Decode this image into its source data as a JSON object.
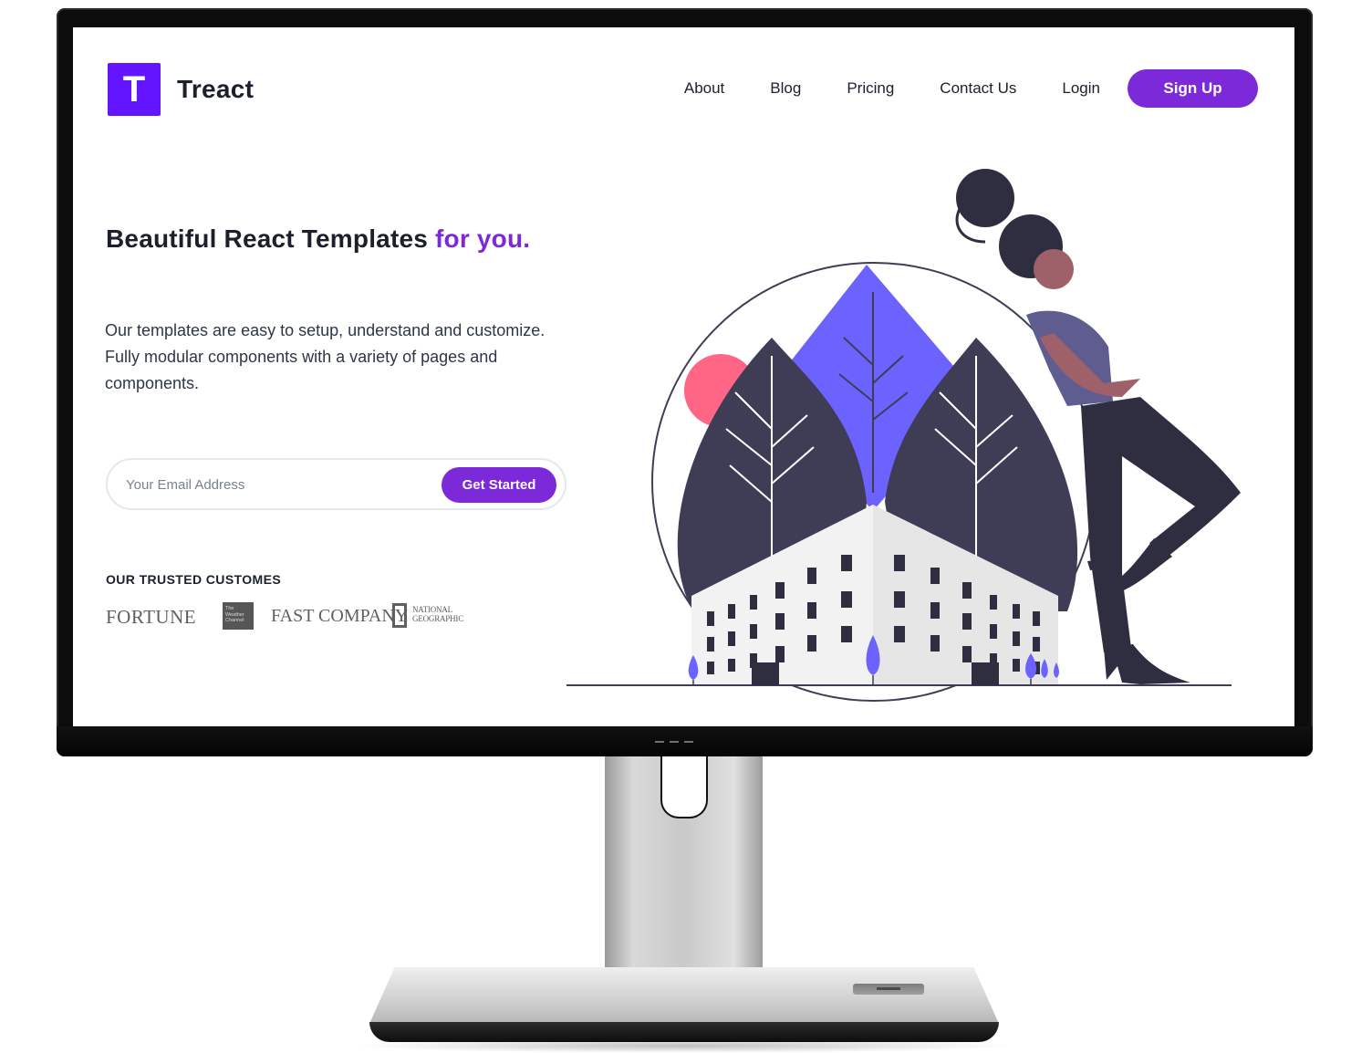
{
  "site": {
    "logo_letter": "T",
    "brand_name": "Treact"
  },
  "nav": {
    "about": "About",
    "blog": "Blog",
    "pricing": "Pricing",
    "contact": "Contact Us",
    "login": "Login",
    "signup": "Sign Up"
  },
  "hero": {
    "title_main": "Beautiful React Templates ",
    "title_accent": "for you.",
    "description": "Our templates are easy to setup, understand and customize. Fully modular components with a variety of pages and components.",
    "email_placeholder": "Your Email Address",
    "cta_label": "Get Started"
  },
  "customers": {
    "title": "OUR TRUSTED CUSTOMES",
    "logos": {
      "fortune": "FORTUNE",
      "weather": "The Weather Channel",
      "fastcompany": "FAST COMPANY",
      "natgeo": "NATIONAL GEOGRAPHIC"
    }
  },
  "colors": {
    "primary": "#6415ff",
    "button": "#7c29d9",
    "illustration_dark": "#3f3d56",
    "illustration_purple": "#6c63ff",
    "illustration_pink": "#ff6584",
    "figure_shirt": "#5f5d8f",
    "figure_skin": "#9e616a",
    "figure_pants": "#2f2e41"
  },
  "icons": {
    "logo": "letter-T-logo",
    "illustration": "woman-leaning-on-globe-with-building-and-trees"
  }
}
